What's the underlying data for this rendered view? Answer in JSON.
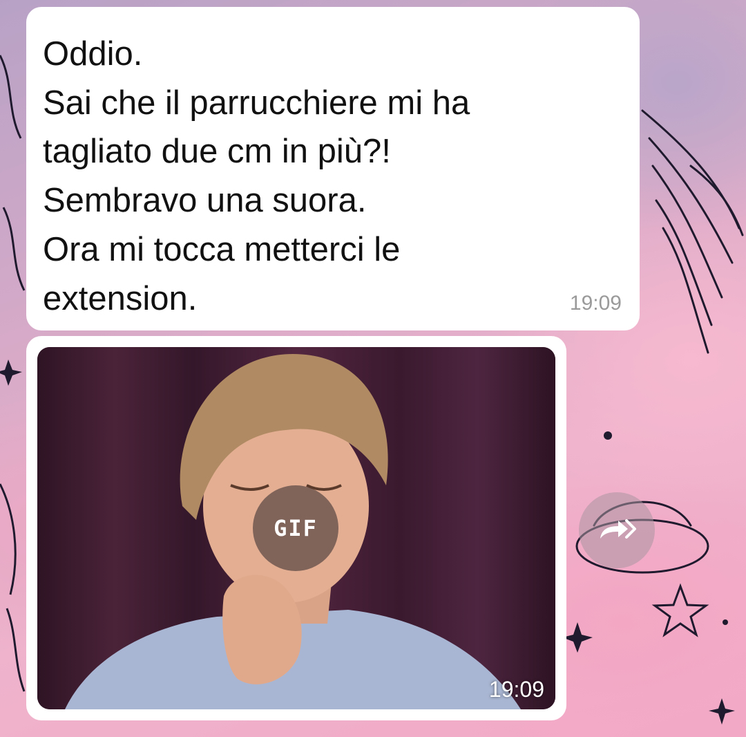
{
  "message": {
    "lines": [
      "Oddio.",
      "Sai che il parrucchiere mi ha",
      "tagliato due cm in più?!",
      "Sembravo una suora.",
      "Ora mi tocca metterci le",
      "extension."
    ],
    "time": "19:09"
  },
  "media": {
    "badge_label": "GIF",
    "time": "19:09"
  },
  "icons": {
    "forward": "forward-icon",
    "play_gif": "gif-play-icon"
  },
  "colors": {
    "bubble": "#ffffff",
    "timestamp": "#9a9a9a",
    "wallpaper_pink": "#efb3cc"
  }
}
